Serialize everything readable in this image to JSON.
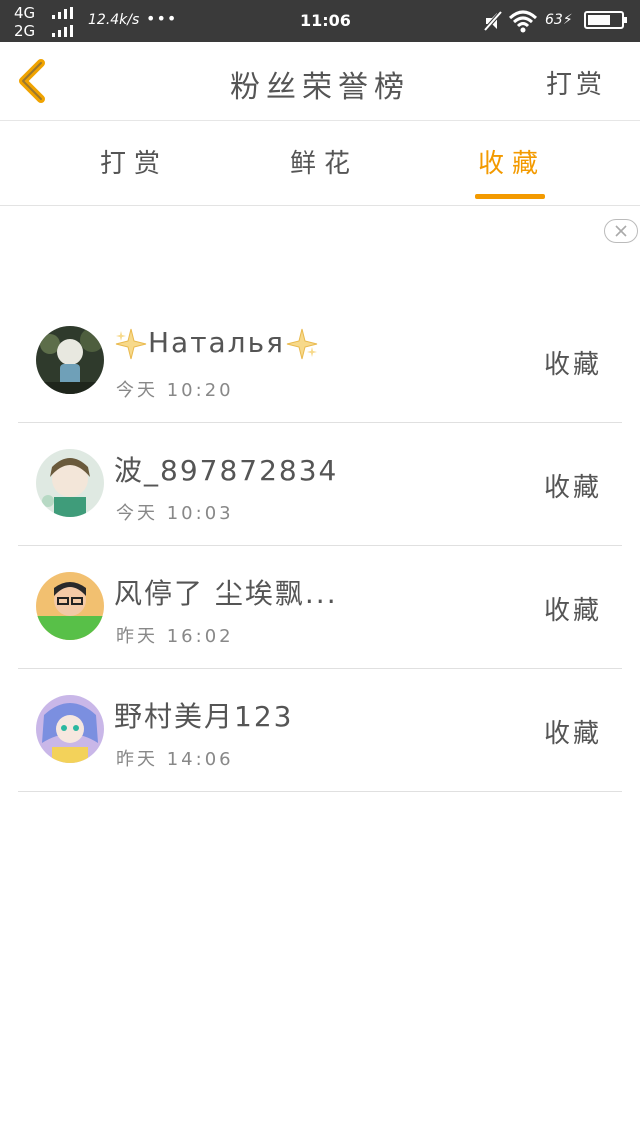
{
  "status_bar": {
    "network1": "4G",
    "network2": "2G",
    "speed": "12.4k/s",
    "dots": "•••",
    "time": "11:06",
    "battery": "63"
  },
  "nav": {
    "title": "粉丝荣誉榜",
    "action": "打赏"
  },
  "tabs": [
    {
      "label": "打赏"
    },
    {
      "label": "鲜花"
    },
    {
      "label": "收藏",
      "active": true
    }
  ],
  "list": [
    {
      "name": "Наталья",
      "time": "今天 10:20",
      "action": "收藏"
    },
    {
      "name": "波_897872834",
      "time": "今天 10:03",
      "action": "收藏"
    },
    {
      "name": "风停了 尘埃飘...",
      "time": "昨天 16:02",
      "action": "收藏"
    },
    {
      "name": "野村美月123",
      "time": "昨天 14:06",
      "action": "收藏"
    }
  ],
  "colors": {
    "accent": "#f39a00",
    "status_bar": "#3a3a3a",
    "text": "#555555"
  }
}
